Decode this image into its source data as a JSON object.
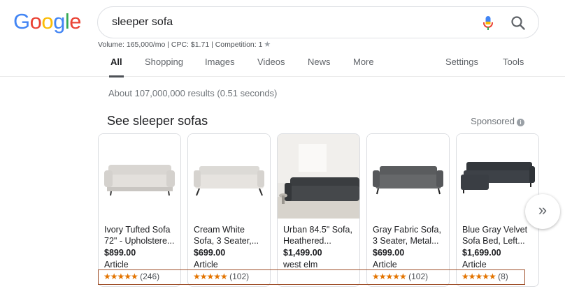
{
  "logo": {
    "letters": [
      {
        "ch": "G",
        "color": "#4285F4"
      },
      {
        "ch": "o",
        "color": "#EA4335"
      },
      {
        "ch": "o",
        "color": "#FBBC05"
      },
      {
        "ch": "g",
        "color": "#4285F4"
      },
      {
        "ch": "l",
        "color": "#34A853"
      },
      {
        "ch": "e",
        "color": "#EA4335"
      }
    ]
  },
  "search": {
    "query": "sleeper sofa",
    "mic_icon": "microphone-icon",
    "search_icon": "magnifier-icon"
  },
  "keyword_stats": {
    "text": "Volume: 165,000/mo | CPC: $1.71 | Competition: 1",
    "star_icon": "star-icon"
  },
  "tabs": {
    "all": "All",
    "shopping": "Shopping",
    "images": "Images",
    "videos": "Videos",
    "news": "News",
    "more": "More",
    "settings": "Settings",
    "tools": "Tools"
  },
  "results_stats": "About 107,000,000 results (0.51 seconds)",
  "shopping": {
    "title": "See sleeper sofas",
    "sponsored": "Sponsored",
    "info_icon": "info-icon",
    "next_icon": "double-chevron-right-icon",
    "products": [
      {
        "title": "Ivory Tufted Sofa 72\" - Upholstere...",
        "price": "$899.00",
        "store": "Article",
        "stars": "★★★★★",
        "rating": 4.5,
        "reviews": "(246)"
      },
      {
        "title": "Cream White Sofa, 3 Seater,...",
        "price": "$699.00",
        "store": "Article",
        "stars": "★★★★★",
        "rating": 4.5,
        "reviews": "(102)"
      },
      {
        "title": "Urban 84.5\" Sofa, Heathered...",
        "price": "$1,499.00",
        "store": "west elm",
        "stars": "",
        "rating": null,
        "reviews": ""
      },
      {
        "title": "Gray Fabric Sofa, 3 Seater, Metal...",
        "price": "$699.00",
        "store": "Article",
        "stars": "★★★★★",
        "rating": 4.5,
        "reviews": "(102)"
      },
      {
        "title": "Blue Gray Velvet Sofa Bed, Left...",
        "price": "$1,699.00",
        "store": "Article",
        "stars": "★★★★★",
        "rating": 5,
        "reviews": "(8)"
      }
    ]
  },
  "colors": {
    "accent_blue": "#1a73e8",
    "star_orange": "#e37400",
    "highlight_border": "#a0522d"
  }
}
